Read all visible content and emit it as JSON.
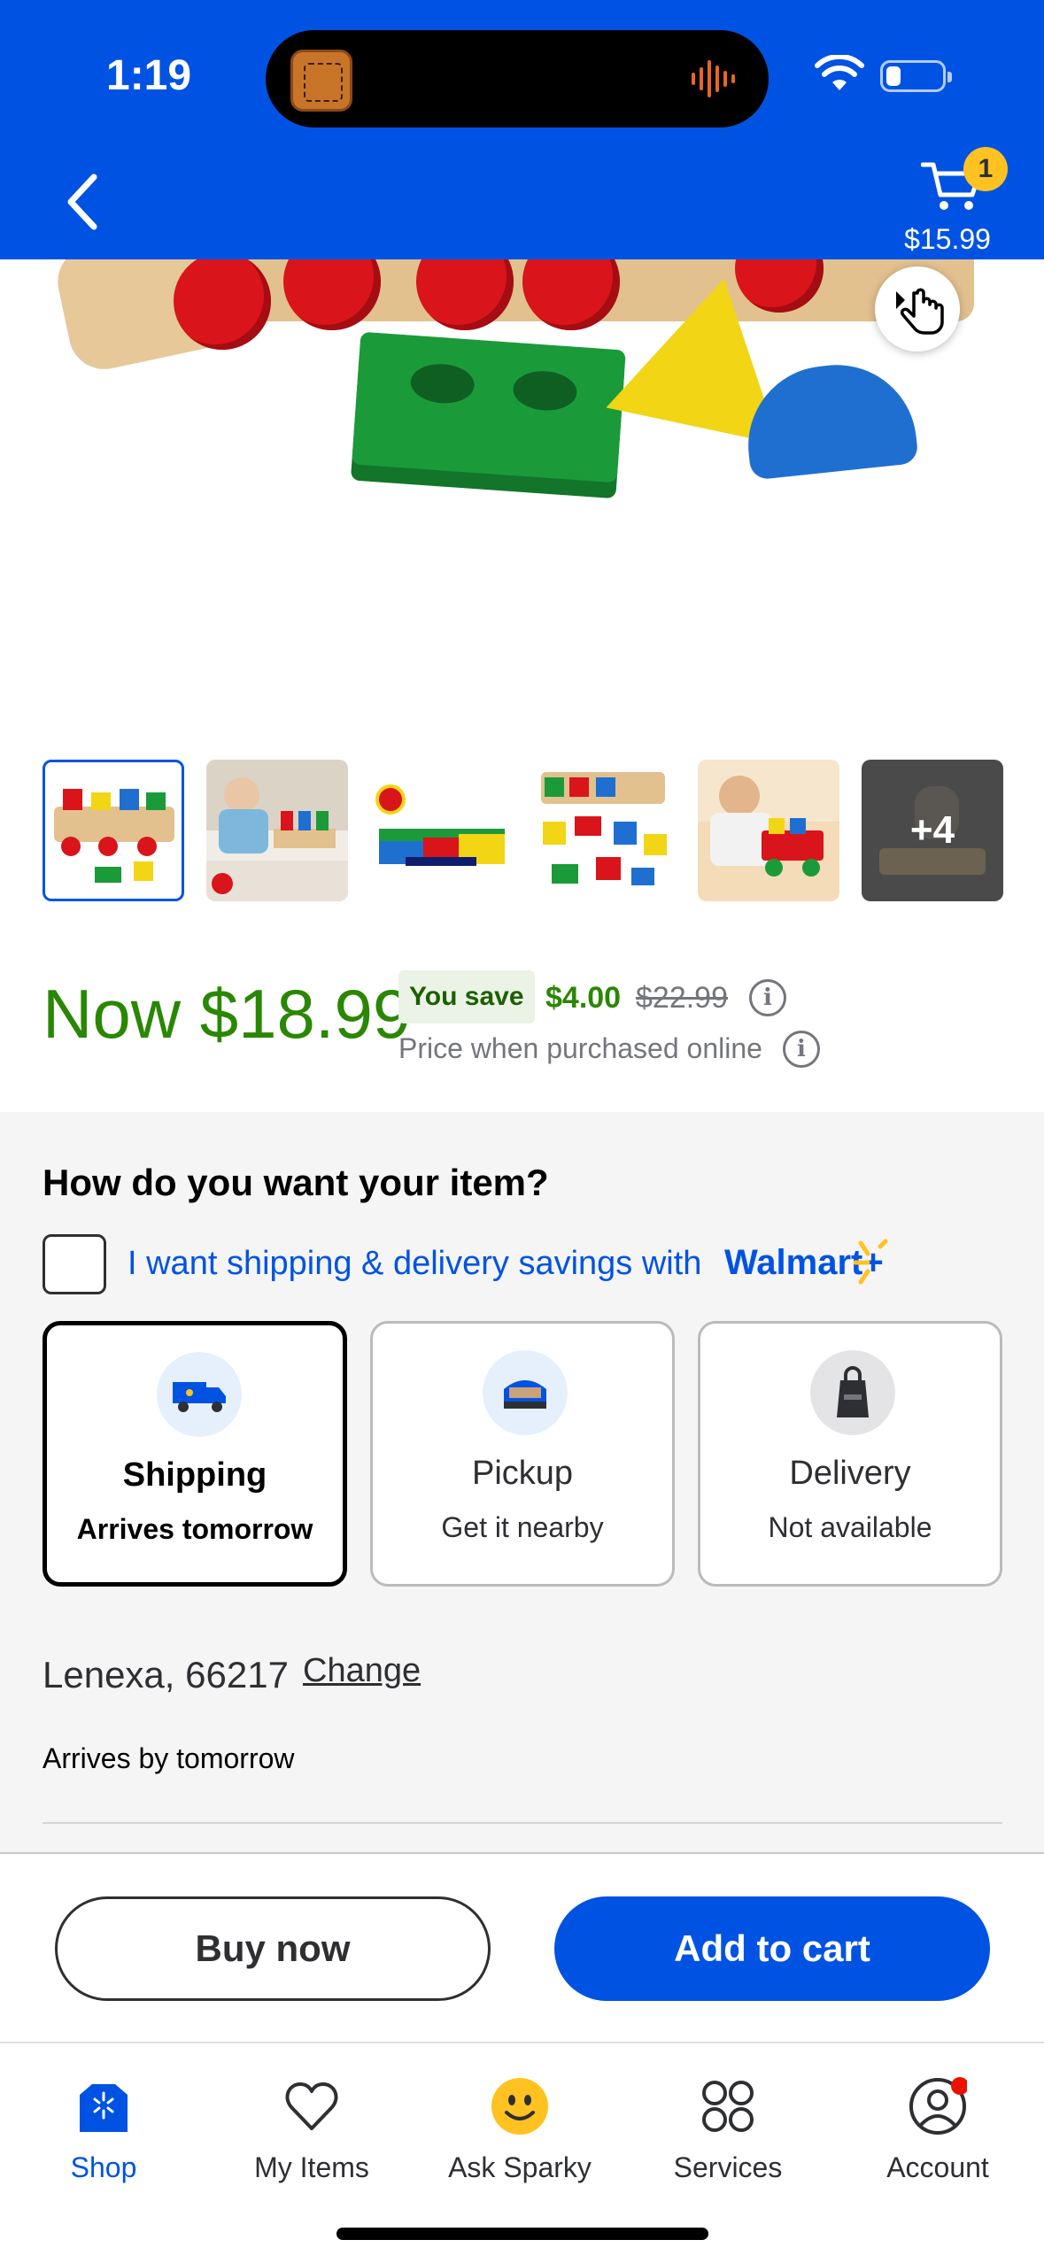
{
  "status_bar": {
    "time": "1:19"
  },
  "header": {
    "back_icon": "chevron-left-icon",
    "cart_count": "1",
    "cart_total": "$15.99"
  },
  "gallery": {
    "more_label": "+4",
    "thumbnails": [
      "thumb-1",
      "thumb-2",
      "thumb-3",
      "thumb-4",
      "thumb-5",
      "thumb-6"
    ]
  },
  "price": {
    "now": "Now $18.99",
    "you_save_label": "You save",
    "save_amount": "$4.00",
    "was_price": "$22.99",
    "note": "Price when purchased online",
    "info_glyph": "i"
  },
  "fulfillment": {
    "title": "How do you want your item?",
    "savings_text": "I want shipping & delivery savings with",
    "walmart_plus": "Walmart+",
    "options": [
      {
        "label": "Shipping",
        "sub": "Arrives tomorrow",
        "icon": "truck-icon"
      },
      {
        "label": "Pickup",
        "sub": "Get it nearby",
        "icon": "car-trunk-icon"
      },
      {
        "label": "Delivery",
        "sub": "Not available",
        "icon": "bag-icon"
      }
    ],
    "location": "Lenexa, 66217",
    "change_label": "Change",
    "arrives": "Arrives by tomorrow"
  },
  "actions": {
    "buy_now": "Buy now",
    "add_to_cart": "Add to cart"
  },
  "tabs": [
    {
      "label": "Shop",
      "icon": "shop-icon"
    },
    {
      "label": "My Items",
      "icon": "heart-icon"
    },
    {
      "label": "Ask Sparky",
      "icon": "sparky-icon"
    },
    {
      "label": "Services",
      "icon": "services-icon"
    },
    {
      "label": "Account",
      "icon": "account-icon"
    }
  ],
  "colors": {
    "brand_blue": "#0053e2",
    "price_green": "#2a8703",
    "badge_yellow": "#ffc220",
    "alert_red": "#ea1100"
  }
}
